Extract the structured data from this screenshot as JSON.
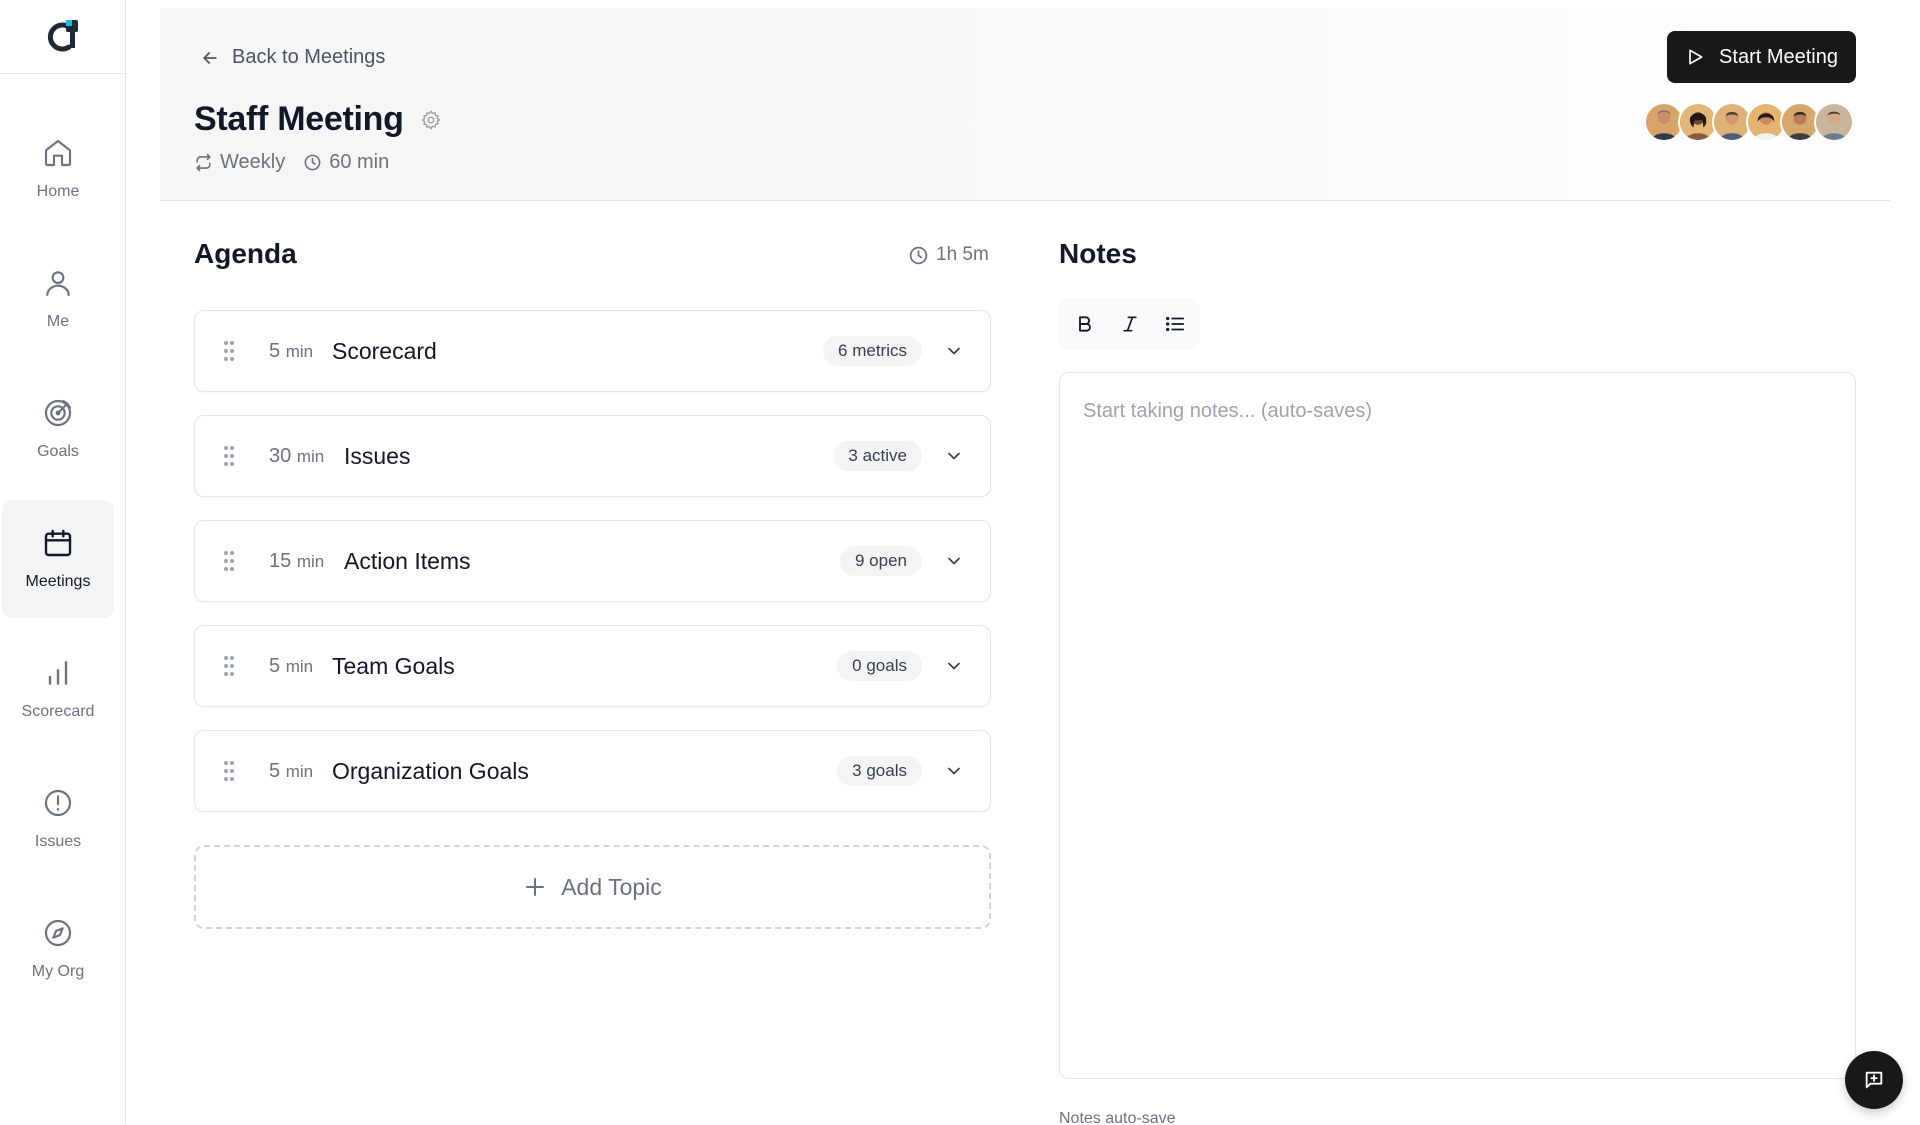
{
  "sidebar": {
    "items": [
      {
        "label": "Home",
        "icon": "home-icon"
      },
      {
        "label": "Me",
        "icon": "user-icon"
      },
      {
        "label": "Goals",
        "icon": "target-icon"
      },
      {
        "label": "Meetings",
        "icon": "calendar-icon",
        "active": true
      },
      {
        "label": "Scorecard",
        "icon": "bar-chart-icon"
      },
      {
        "label": "Issues",
        "icon": "alert-circle-icon"
      },
      {
        "label": "My Org",
        "icon": "compass-icon"
      }
    ]
  },
  "header": {
    "back_label": "Back to Meetings",
    "title": "Staff Meeting",
    "recurrence": "Weekly",
    "duration": "60 min",
    "start_button": "Start Meeting",
    "accent": "#18181b"
  },
  "agenda": {
    "title": "Agenda",
    "total_time": "1h 5m",
    "topics": [
      {
        "minutes": "5",
        "unit": "min",
        "name": "Scorecard",
        "badge": "6 metrics"
      },
      {
        "minutes": "30",
        "unit": "min",
        "name": "Issues",
        "badge": "3 active"
      },
      {
        "minutes": "15",
        "unit": "min",
        "name": "Action Items",
        "badge": "9 open"
      },
      {
        "minutes": "5",
        "unit": "min",
        "name": "Team Goals",
        "badge": "0 goals"
      },
      {
        "minutes": "5",
        "unit": "min",
        "name": "Organization Goals",
        "badge": "3 goals"
      }
    ],
    "add_topic": "Add Topic"
  },
  "notes": {
    "title": "Notes",
    "placeholder": "Start taking notes... (auto-saves)",
    "autosave_label": "Notes auto-save"
  }
}
